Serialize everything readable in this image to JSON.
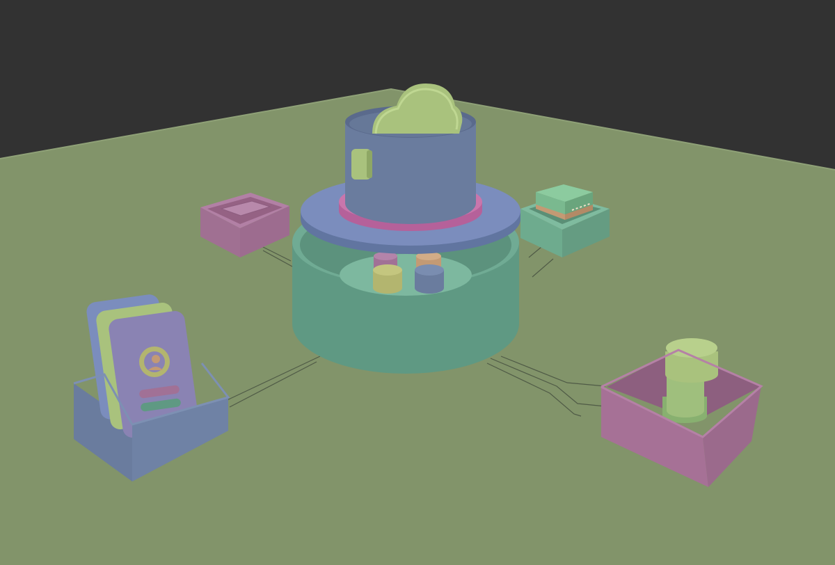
{
  "scene": {
    "colors": {
      "background": "#323232",
      "ground": "#82946a",
      "teal": "#5f9983",
      "blue": "#6a7c9e",
      "pink": "#a67196",
      "green": "#a9c27d",
      "olive": "#b3b56f",
      "orange": "#c39a74",
      "cable": "#4f5a46"
    },
    "objects": [
      {
        "name": "central-server-tower",
        "icon": "cloud-icon"
      },
      {
        "name": "pink-tray-box",
        "icon": "tray-icon"
      },
      {
        "name": "green-chip-box",
        "icon": "chip-icon"
      },
      {
        "name": "id-card-box",
        "icon": "user-card-icon"
      },
      {
        "name": "bottle-box",
        "icon": "bottle-icon"
      }
    ]
  }
}
